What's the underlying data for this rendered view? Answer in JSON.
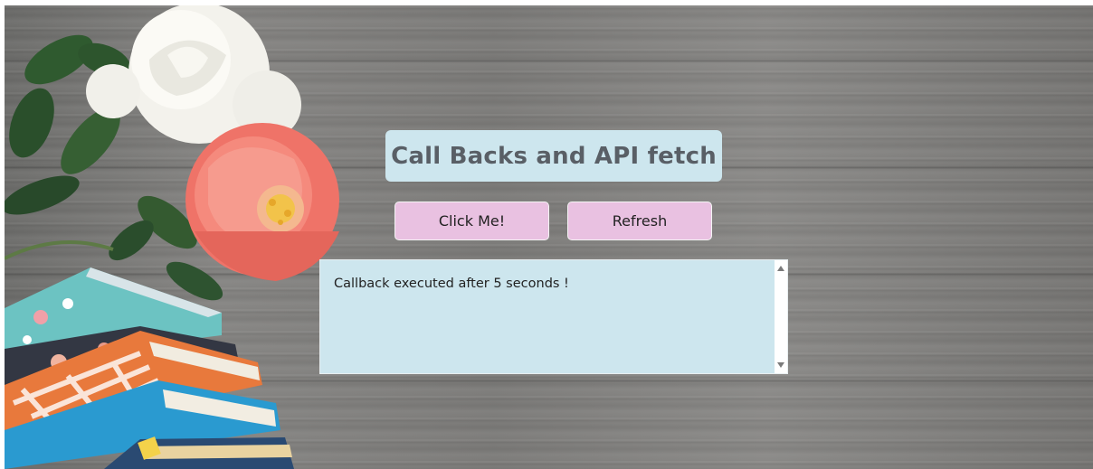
{
  "page": {
    "title": "Call Backs and API fetch"
  },
  "buttons": {
    "click_label": "Click Me!",
    "refresh_label": "Refresh"
  },
  "output": {
    "text": "Callback executed after 5 seconds !"
  },
  "colors": {
    "title_bg": "#cde6ee",
    "button_bg": "#e9c1e1",
    "output_bg": "#cde6ee",
    "title_text": "#595f66"
  },
  "icons": {
    "scroll_up": "scroll-up-arrow-icon",
    "scroll_down": "scroll-down-arrow-icon"
  }
}
